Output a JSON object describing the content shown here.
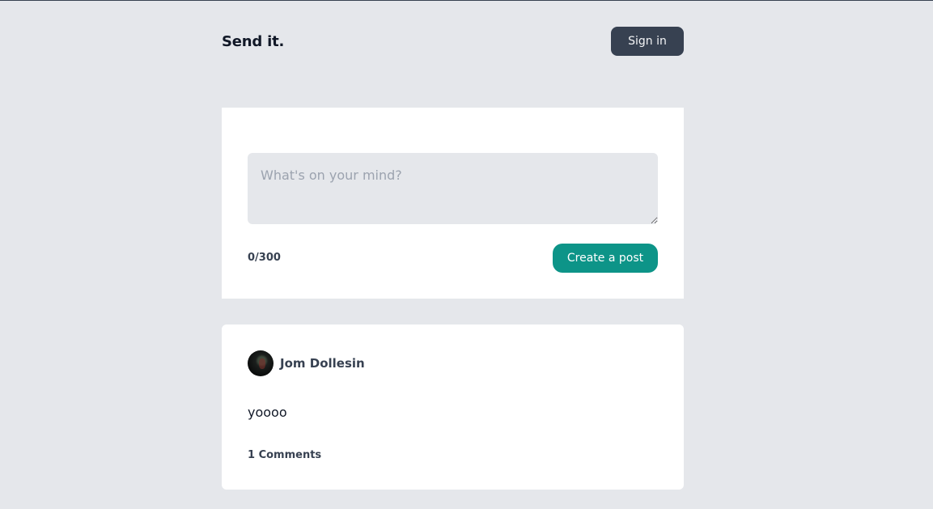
{
  "header": {
    "brand": "Send it.",
    "sign_in_label": "Sign in"
  },
  "composer": {
    "placeholder": "What's on your mind?",
    "value": "",
    "counter": "0/300",
    "submit_label": "Create a post"
  },
  "posts": [
    {
      "author": "Jom Dollesin",
      "text": "yoooo",
      "comments_label": "1 Comments"
    }
  ],
  "colors": {
    "background": "#e5e7eb",
    "sign_in_button": "#374151",
    "primary_button": "#0d9488",
    "card": "#ffffff"
  }
}
